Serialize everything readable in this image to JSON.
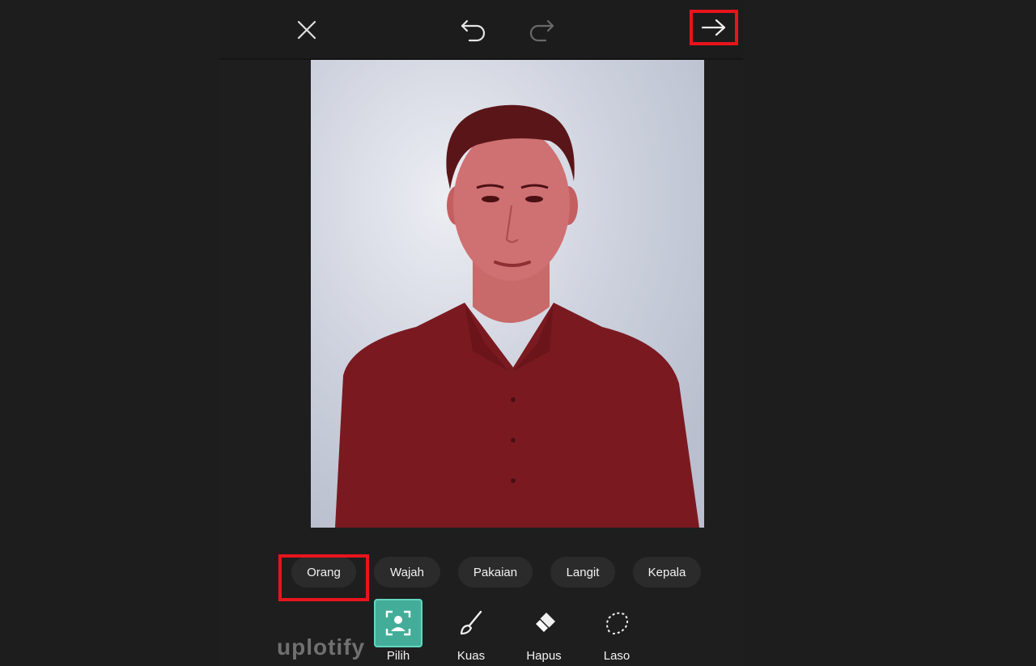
{
  "toolbar": {
    "close_icon": "close-icon",
    "undo_icon": "undo-icon",
    "redo_icon": "redo-icon",
    "next_icon": "arrow-right-icon"
  },
  "selection_chips": [
    {
      "label": "Orang",
      "selected": true
    },
    {
      "label": "Wajah",
      "selected": false
    },
    {
      "label": "Pakaian",
      "selected": false
    },
    {
      "label": "Langit",
      "selected": false
    },
    {
      "label": "Kepala",
      "selected": false
    }
  ],
  "tools": [
    {
      "label": "Pilih",
      "icon": "person-select-icon",
      "active": true
    },
    {
      "label": "Kuas",
      "icon": "brush-icon",
      "active": false
    },
    {
      "label": "Hapus",
      "icon": "eraser-icon",
      "active": false
    },
    {
      "label": "Laso",
      "icon": "lasso-icon",
      "active": false
    }
  ],
  "watermark": "uplotify",
  "colors": {
    "accent": "#43ad99",
    "highlight": "#e8141c",
    "mask_overlay": "#8c1e24"
  }
}
